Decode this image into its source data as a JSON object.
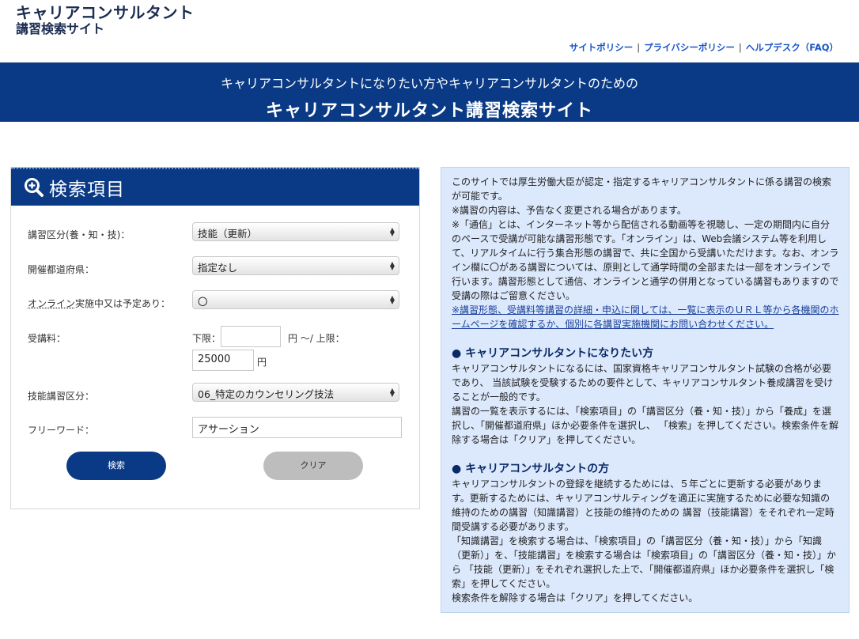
{
  "logo": {
    "line1": "キャリアコンサルタント",
    "line2": "講習検索サイト"
  },
  "toplinks": [
    "サイトポリシー",
    "プライバシーポリシー",
    "ヘルプデスク（FAQ）"
  ],
  "toplinks_sep": "|",
  "banner": {
    "sub": "キャリアコンサルタントになりたい方やキャリアコンサルタントのための",
    "main": "キャリアコンサルタント講習検索サイト"
  },
  "search": {
    "title": "検索項目",
    "course_type_label": "講習区分(養・知・技)：",
    "course_type_value": "技能（更新）",
    "prefecture_label": "開催都道府県：",
    "prefecture_value": "指定なし",
    "online_label_underlined": "オンライン",
    "online_label_rest": "実施中又は予定あり：",
    "online_value": "〇",
    "fee_label": "受講料：",
    "fee_lower_label": "下限：",
    "fee_lower_value": "",
    "fee_mid_label": "円 〜/ 上限：",
    "fee_upper_value": "25000",
    "fee_unit": "円",
    "skill_label": "技能講習区分：",
    "skill_value": "06_特定のカウンセリング技法",
    "freeword_label": "フリーワード：",
    "freeword_value": "アサーション",
    "search_button": "検索",
    "clear_button": "クリア"
  },
  "info": {
    "intro": "このサイトでは厚生労働大臣が認定・指定するキャリアコンサルタントに係る講習の検索が可能です。",
    "note1": "※講習の内容は、予告なく変更される場合があります。",
    "note2": "※「通信」とは、インターネット等から配信される動画等を視聴し、一定の期間内に自分のペースで受講が可能な講習形態です。「オンライン」は、Web会議システム等を利用して、リアルタイムに行う集合形態の講習で、共に全国から受講いただけます。なお、オンライン欄に〇がある講習については、原則として通学時間の全部または一部をオンラインで行います。講習形態として通信、オンラインと通学の併用となっている講習もありますので受講の際はご留意ください。",
    "note3": "※講習形態、受講料等講習の詳細・申込に関しては、一覧に表示のＵＲＬ等から各機関のホームページを確認するか、個別に各講習実施機関にお問い合わせください。",
    "heading1": "● キャリアコンサルタントになりたい方",
    "section1_p1": "キャリアコンサルタントになるには、国家資格キャリアコンサルタント試験の合格が必要であり、 当該試験を受験するための要件として、キャリアコンサルタント養成講習を受けることが一般的です。",
    "section1_p2": "講習の一覧を表示するには、「検索項目」の「講習区分（養・知・技）」から「養成」を選択し、「開催都道府県」ほか必要条件を選択し、 「検索」を押してください。検索条件を解除する場合は「クリア」を押してください。",
    "heading2": "● キャリアコンサルタントの方",
    "section2_p1": "キャリアコンサルタントの登録を継続するためには、５年ごとに更新する必要があります。更新するためには、キャリアコンサルティングを適正に実施するために必要な知識の維持のための講習（知識講習）と技能の維持のための 講習（技能講習）をそれぞれ一定時間受講する必要があります。",
    "section2_p2": "「知識講習」を検索する場合は、「検索項目」の「講習区分（養・知・技）」から「知識（更新）」を、「技能講習」を検索する場合は「検索項目」の「講習区分（養・知・技）」から 「技能（更新）」をそれぞれ選択した上で、「開催都道府県」ほか必要条件を選択し「検索」を押してください。",
    "section2_p3": "検索条件を解除する場合は「クリア」を押してください。"
  }
}
